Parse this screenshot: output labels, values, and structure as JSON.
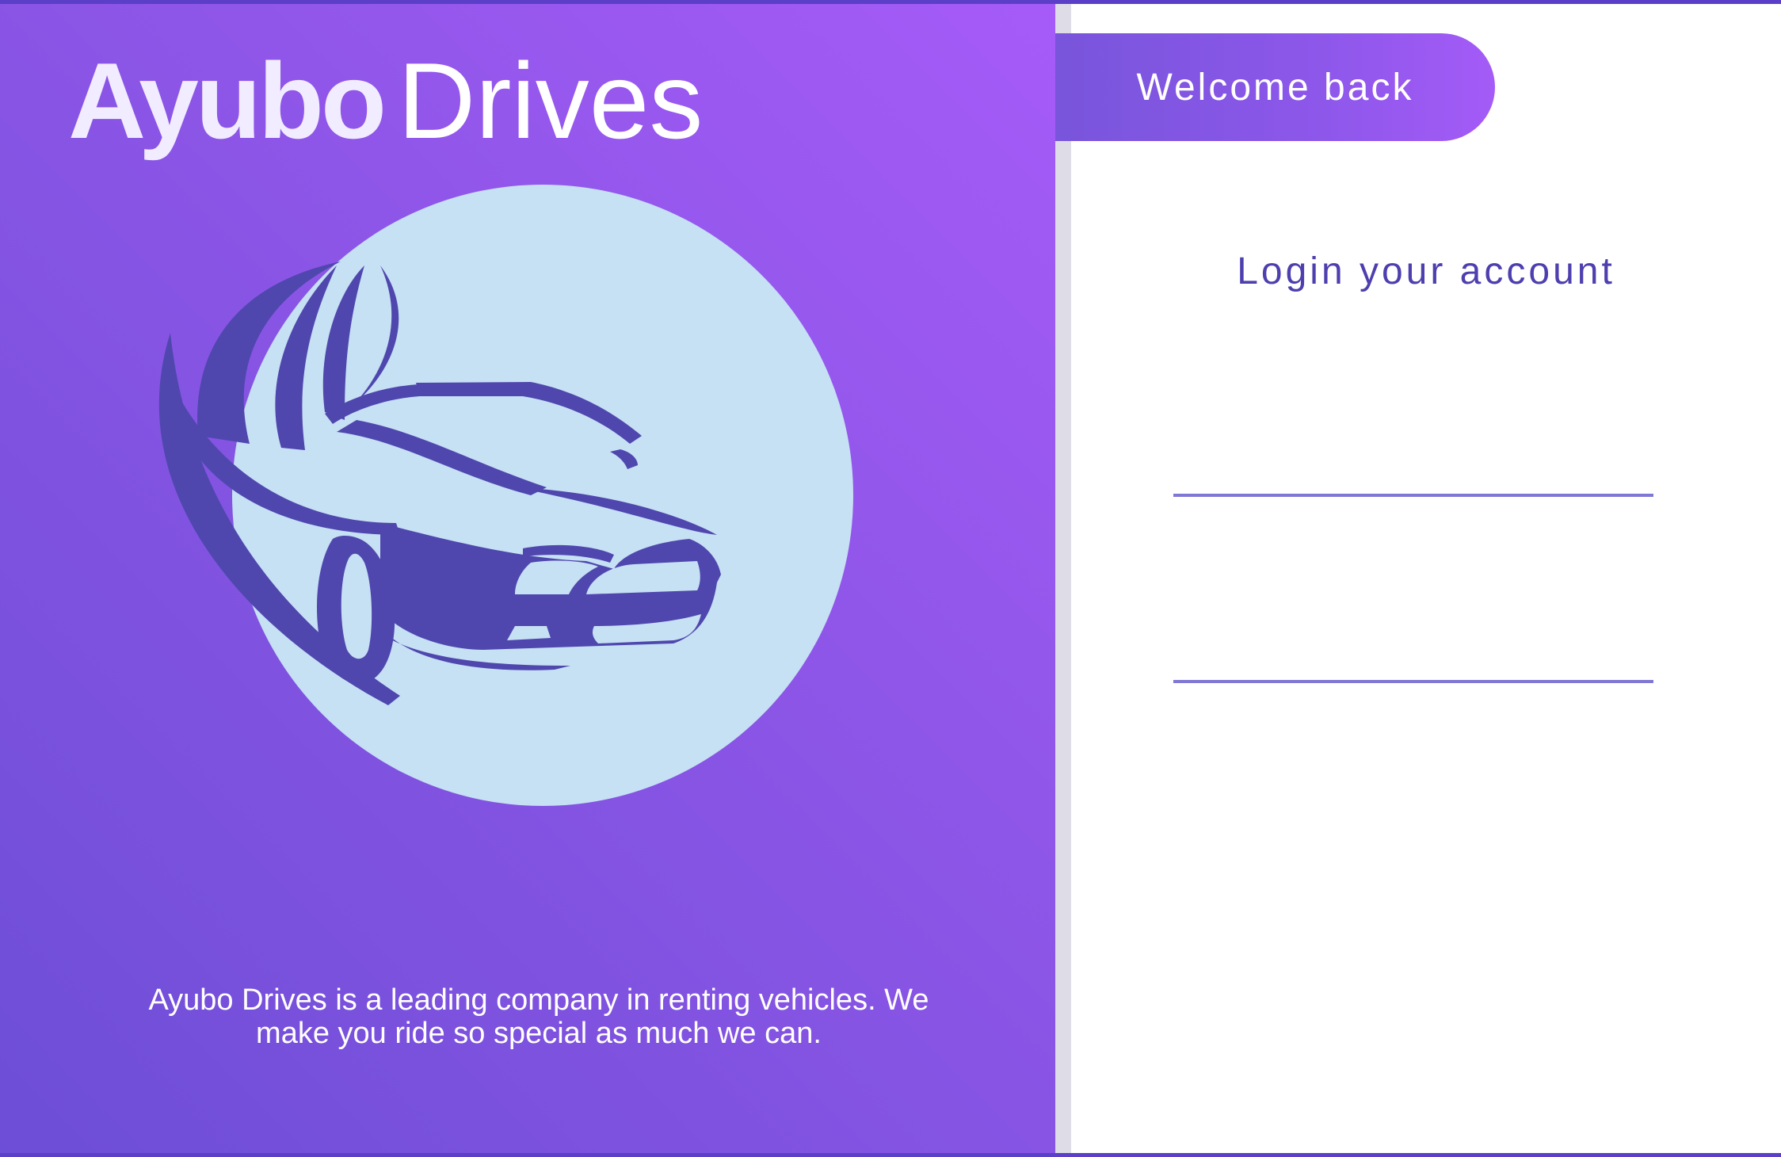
{
  "brand": {
    "name_bold": "Ayubo",
    "name_light": "Drives",
    "tagline_line1": "Ayubo Drives is a leading company in renting vehicles. We",
    "tagline_line2": "make you ride so special as much we can."
  },
  "logo": {
    "icon": "car-icon",
    "circle_color": "#c6e0f4",
    "car_color": "#4f47ae"
  },
  "login": {
    "welcome_label": "Welcome back",
    "heading": "Login your account",
    "username_value": "",
    "password_value": ""
  },
  "colors": {
    "gradient_start": "#6d4ed6",
    "gradient_end": "#a65bf8",
    "heading_color": "#4d3fae",
    "field_line": "#8078d6"
  }
}
